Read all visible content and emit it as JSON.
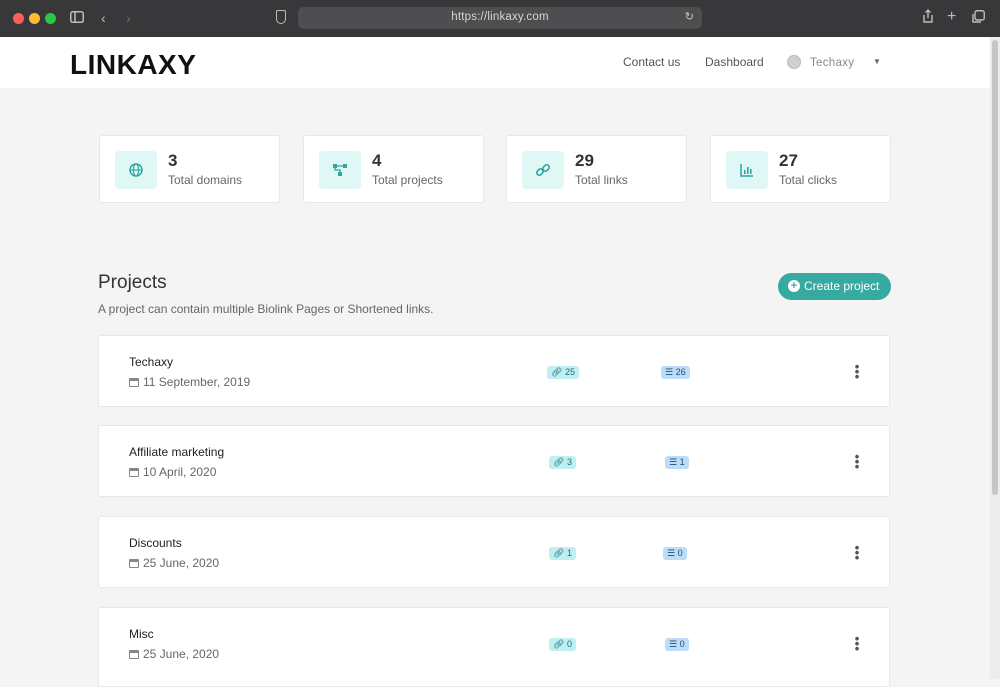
{
  "browser": {
    "url": "https://linkaxy.com"
  },
  "header": {
    "logo": "LINKAXY",
    "nav": {
      "contact": "Contact us",
      "dashboard": "Dashboard"
    },
    "user": {
      "name": "Techaxy"
    }
  },
  "stats": [
    {
      "value": "3",
      "label": "Total domains",
      "icon": "globe-icon"
    },
    {
      "value": "4",
      "label": "Total projects",
      "icon": "project-tree-icon"
    },
    {
      "value": "29",
      "label": "Total links",
      "icon": "link-icon"
    },
    {
      "value": "27",
      "label": "Total clicks",
      "icon": "chart-icon"
    }
  ],
  "projects_section": {
    "title": "Projects",
    "description": "A project can contain multiple Biolink Pages or Shortened links.",
    "create_label": "Create project"
  },
  "projects": [
    {
      "name": "Techaxy",
      "date": "11 September, 2019",
      "links": "25",
      "clicks": "26"
    },
    {
      "name": "Affiliate marketing",
      "date": "10 April, 2020",
      "links": "3",
      "clicks": "1"
    },
    {
      "name": "Discounts",
      "date": "25 June, 2020",
      "links": "1",
      "clicks": "0"
    },
    {
      "name": "Misc",
      "date": "25 June, 2020",
      "links": "0",
      "clicks": "0"
    }
  ],
  "colors": {
    "accent": "#36a9a0",
    "stat_icon_bg": "#dff7f5",
    "links_badge": "#bfeff0",
    "clicks_badge": "#bcdcf8"
  }
}
